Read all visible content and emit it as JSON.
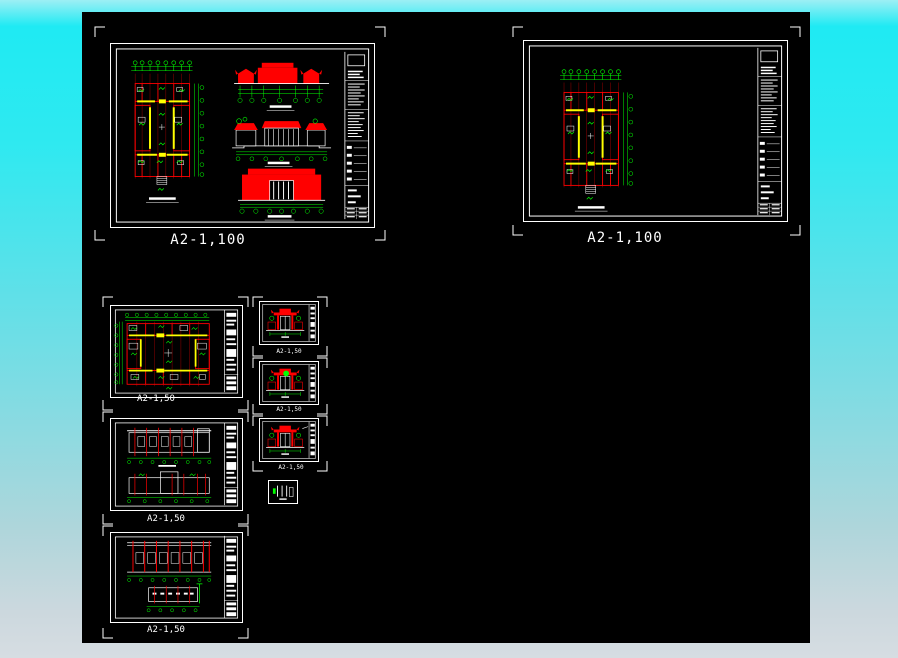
{
  "app": {
    "view": "cad-model-space"
  },
  "colors": {
    "desktop_top": "#1feaf3",
    "desktop_bottom": "#d6dde2",
    "canvas_background": "#000000",
    "line_white": "#ffffff",
    "line_red": "#ff0000",
    "line_green": "#00ff00",
    "line_yellow": "#ffff00"
  },
  "sheets": {
    "plan100_combined": {
      "label": "A2-1,100"
    },
    "plan100_single": {
      "label": "A2-1,100"
    },
    "plan50": {
      "label": "A2-1,50"
    },
    "elevations_a": {
      "label": "A2-1,50"
    },
    "elevations_b": {
      "label": "A2-1,50"
    },
    "gate_a": {
      "label": "A2-1,50"
    },
    "gate_b": {
      "label": "A2-1,50"
    },
    "gate_c": {
      "label": "A2-1,50"
    }
  }
}
